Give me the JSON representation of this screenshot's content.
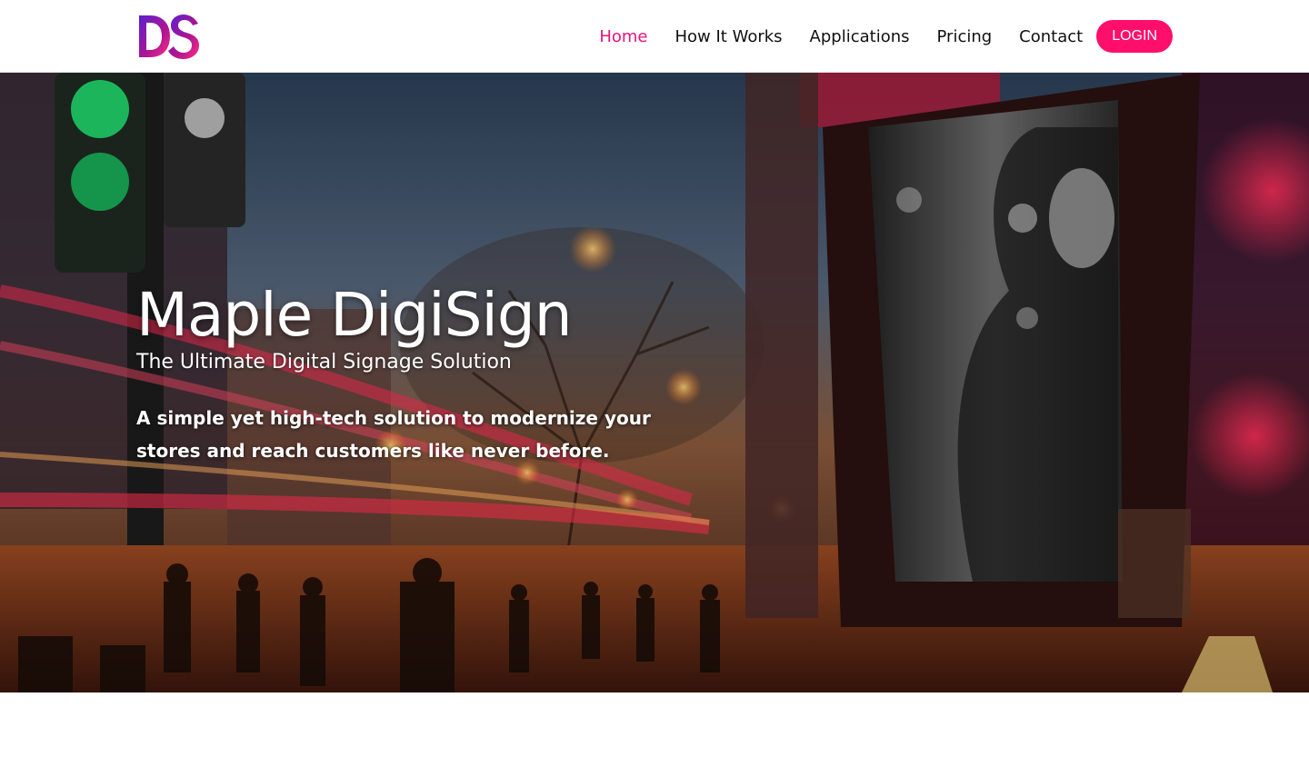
{
  "colors": {
    "accent": "#e5137f",
    "login_bg": "#ff0f6b",
    "nav_text": "#111111",
    "logo_gradient": [
      "#5b1fd1",
      "#e5137f"
    ]
  },
  "header": {
    "logo": {
      "icon": "ds-logo-icon",
      "text": "DS"
    },
    "nav": [
      {
        "label": "Home",
        "active": true
      },
      {
        "label": "How It Works",
        "active": false
      },
      {
        "label": "Applications",
        "active": false
      },
      {
        "label": "Pricing",
        "active": false
      },
      {
        "label": "Contact",
        "active": false
      }
    ],
    "login_label": "LOGIN"
  },
  "hero": {
    "title": "Maple DigiSign",
    "subtitle": "The Ultimate Digital Signage Solution",
    "description": "A simple yet high-tech solution to modernize your stores and reach customers like never before."
  }
}
